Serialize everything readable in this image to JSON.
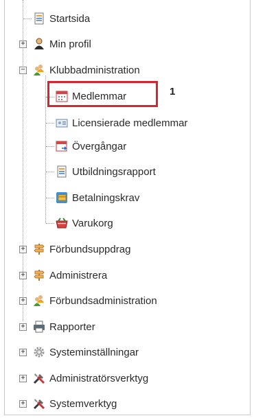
{
  "tree": {
    "items": [
      {
        "label": "Startsida",
        "icon": "page-icon",
        "expander": ""
      },
      {
        "label": "Min profil",
        "icon": "user-icon",
        "expander": "+"
      },
      {
        "label": "Klubbadministration",
        "icon": "group-icon",
        "expander": "−"
      },
      {
        "label": "Medlemmar",
        "icon": "calendar-icon",
        "expander": ""
      },
      {
        "label": "Licensierade medlemmar",
        "icon": "id-card-icon",
        "expander": ""
      },
      {
        "label": "Övergångar",
        "icon": "calendar-transfer-icon",
        "expander": ""
      },
      {
        "label": "Utbildningsrapport",
        "icon": "report-icon",
        "expander": ""
      },
      {
        "label": "Betalningskrav",
        "icon": "payment-icon",
        "expander": ""
      },
      {
        "label": "Varukorg",
        "icon": "cart-icon",
        "expander": ""
      },
      {
        "label": "Förbundsuppdrag",
        "icon": "signpost-icon",
        "expander": "+"
      },
      {
        "label": "Administrera",
        "icon": "signpost-icon",
        "expander": "+"
      },
      {
        "label": "Förbundsadministration",
        "icon": "group-icon",
        "expander": "+"
      },
      {
        "label": "Rapporter",
        "icon": "printer-icon",
        "expander": "+"
      },
      {
        "label": "Systeminställningar",
        "icon": "gear-icon",
        "expander": "+"
      },
      {
        "label": "Administratörsverktyg",
        "icon": "tools-icon",
        "expander": "+"
      },
      {
        "label": "Systemverktyg",
        "icon": "tools-icon",
        "expander": "+"
      }
    ]
  },
  "annotation": {
    "marker": "1"
  },
  "colors": {
    "highlight": "#d9232e",
    "tree_lines": "#9a9a9a"
  }
}
